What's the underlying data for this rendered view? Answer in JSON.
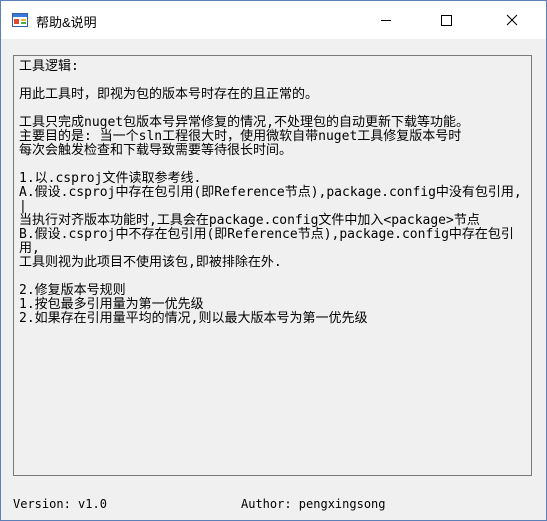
{
  "window": {
    "title": "帮助&说明",
    "icon": "windows-form-icon",
    "controls": {
      "minimize": "minimize-icon",
      "maximize": "maximize-icon",
      "close": "close-icon"
    }
  },
  "help_text": {
    "lines": [
      "工具逻辑:",
      "",
      "用此工具时，即视为包的版本号时存在的且正常的。",
      "",
      "工具只完成nuget包版本号异常修复的情况,不处理包的自动更新下载等功能。",
      "主要目的是: 当一个sln工程很大时，使用微软自带nuget工具修复版本号时",
      "每次会触发检查和下载导致需要等待很长时间。",
      "",
      "1.以.csproj文件读取参考线.",
      "A.假设.csproj中存在包引用(即Reference节点),package.config中没有包引用,|",
      "当执行对齐版本功能时,工具会在package.config文件中加入<package>节点",
      "B.假设.csproj中不存在包引用(即Reference节点),package.config中存在包引用,",
      "工具则视为此项目不使用该包,即被排除在外.",
      "",
      "2.修复版本号规则",
      "1.按包最多引用量为第一优先级",
      "2.如果存在引用量平均的情况,则以最大版本号为第一优先级"
    ]
  },
  "footer": {
    "version": "Version: v1.0",
    "author": "Author: pengxingsong"
  }
}
